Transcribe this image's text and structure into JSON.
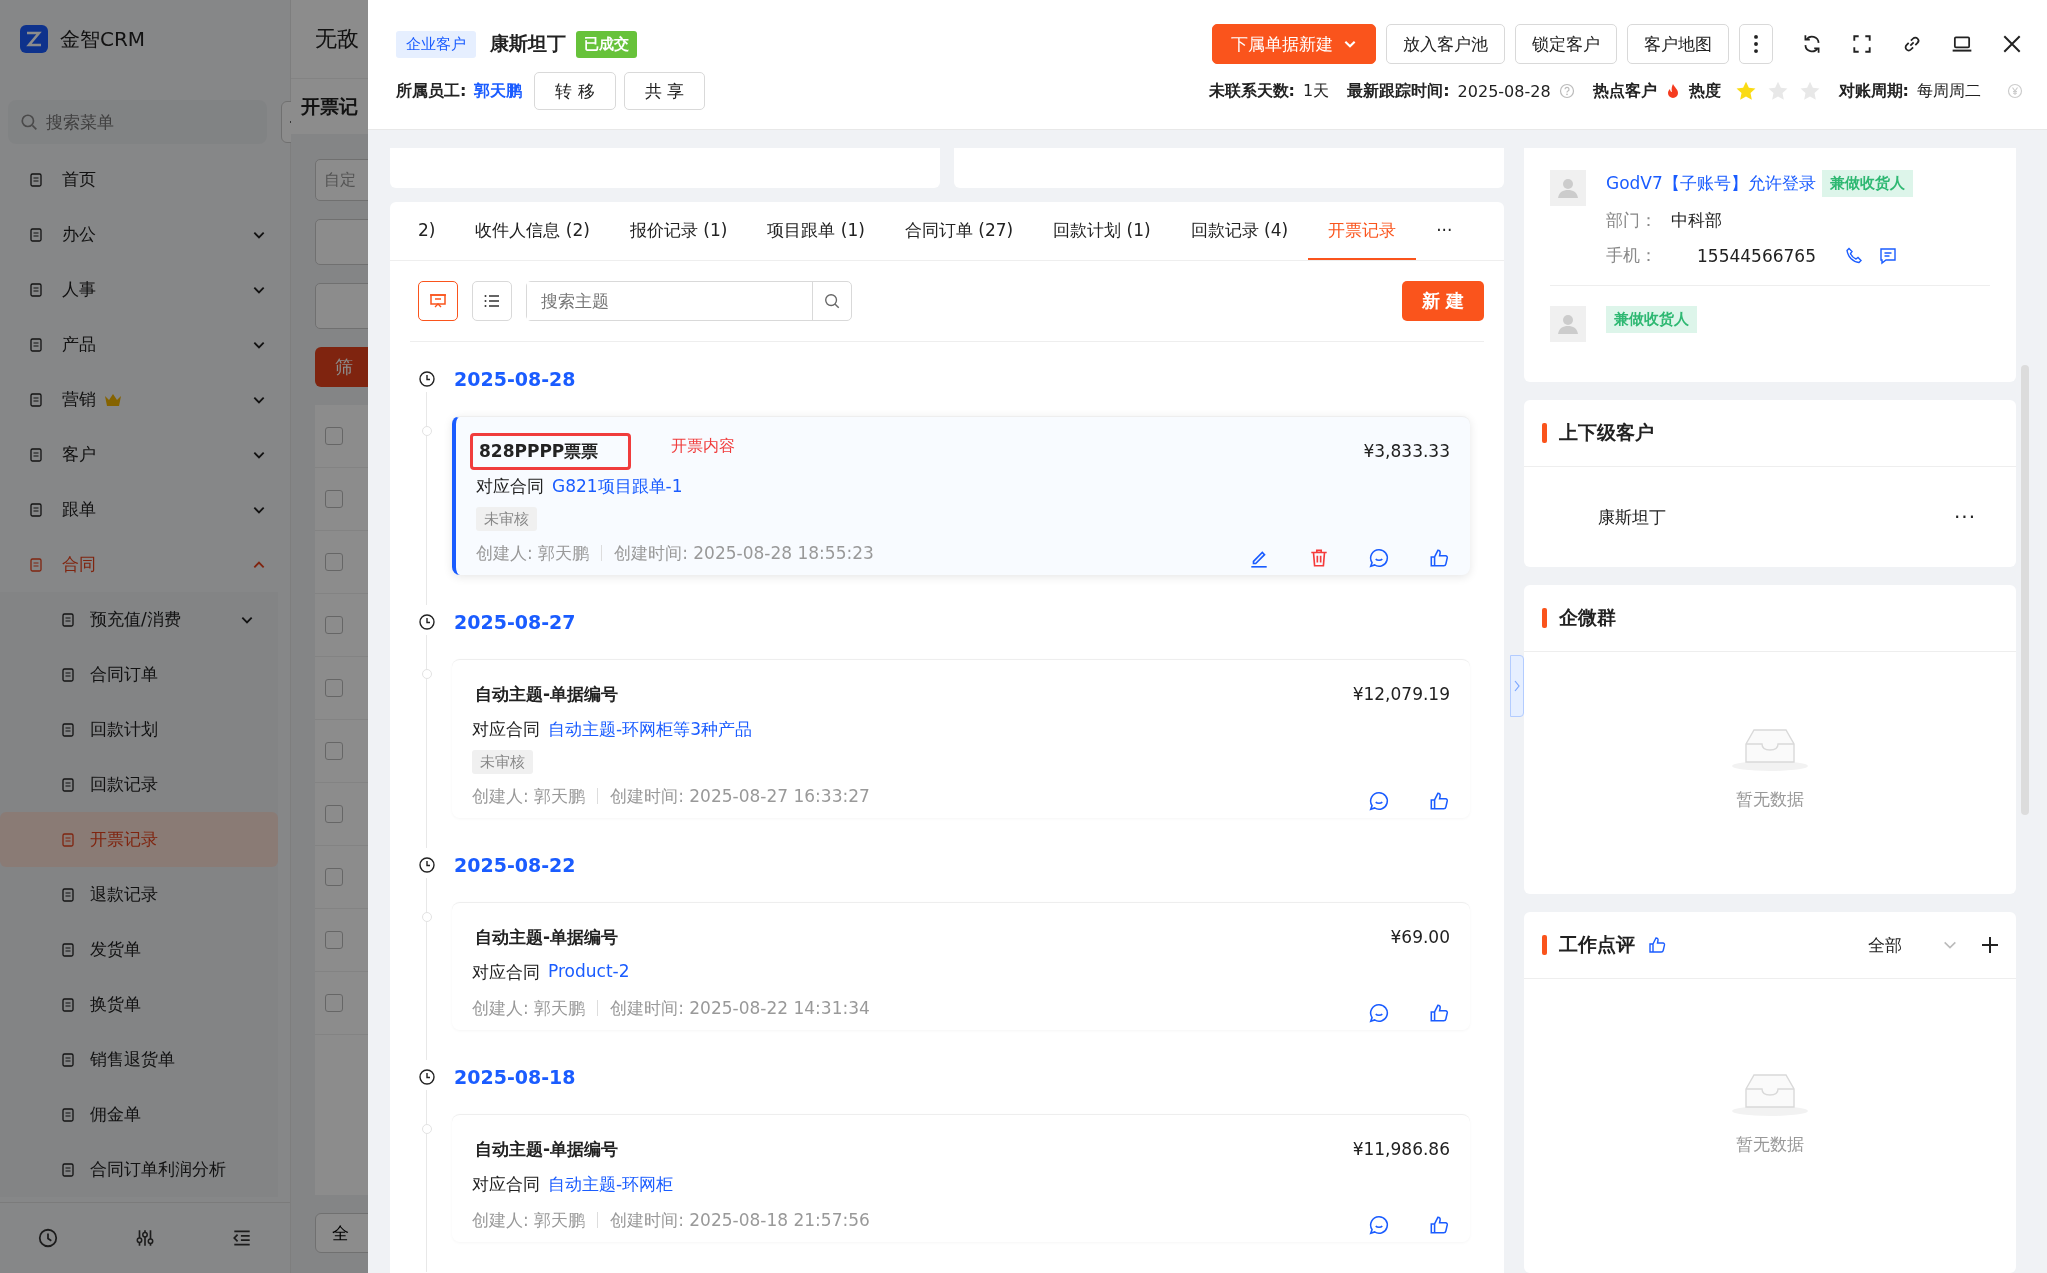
{
  "app": {
    "logo": "金智CRM",
    "search_placeholder": "搜索菜单",
    "page_title": "无敌",
    "section_title": "开票记",
    "filter_placeholder": "自定",
    "filter_button": "筛",
    "footer_button": "全",
    "table_rows": [
      {
        "checked": false
      },
      {
        "checked": false
      },
      {
        "checked": false
      },
      {
        "checked": false
      },
      {
        "checked": false
      },
      {
        "checked": false
      },
      {
        "checked": false
      },
      {
        "checked": false
      },
      {
        "checked": false
      },
      {
        "checked": false
      }
    ]
  },
  "sidebar": {
    "items": [
      {
        "label": "首页",
        "kind": "link",
        "selected": false,
        "premium": false
      },
      {
        "label": "办公",
        "kind": "group",
        "selected": false,
        "expanded": false,
        "premium": false
      },
      {
        "label": "人事",
        "kind": "group",
        "selected": false,
        "expanded": false,
        "premium": false
      },
      {
        "label": "产品",
        "kind": "group",
        "selected": false,
        "expanded": false,
        "premium": false
      },
      {
        "label": "营销",
        "kind": "group",
        "selected": false,
        "expanded": false,
        "premium": true
      },
      {
        "label": "客户",
        "kind": "group",
        "selected": false,
        "expanded": false,
        "premium": false
      },
      {
        "label": "跟单",
        "kind": "group",
        "selected": false,
        "expanded": false,
        "premium": false
      },
      {
        "label": "合同",
        "kind": "group",
        "selected": true,
        "expanded": true,
        "premium": false,
        "children": [
          {
            "label": "预充值/消费",
            "kind": "group",
            "selected": false
          },
          {
            "label": "合同订单",
            "kind": "link",
            "selected": false
          },
          {
            "label": "回款计划",
            "kind": "link",
            "selected": false
          },
          {
            "label": "回款记录",
            "kind": "link",
            "selected": false
          },
          {
            "label": "开票记录",
            "kind": "link",
            "selected": true
          },
          {
            "label": "退款记录",
            "kind": "link",
            "selected": false
          },
          {
            "label": "发货单",
            "kind": "link",
            "selected": false
          },
          {
            "label": "换货单",
            "kind": "link",
            "selected": false
          },
          {
            "label": "销售退货单",
            "kind": "link",
            "selected": false
          },
          {
            "label": "佣金单",
            "kind": "link",
            "selected": false
          },
          {
            "label": "合同订单利润分析",
            "kind": "link",
            "selected": false
          }
        ]
      }
    ]
  },
  "customer": {
    "type_tag": "企业客户",
    "name": "康斯坦丁",
    "status": "已成交"
  },
  "header_buttons": [
    {
      "label": "下属单据新建",
      "kind": "primary"
    },
    {
      "label": "放入客户池",
      "kind": "default"
    },
    {
      "label": "锁定客户",
      "kind": "default"
    },
    {
      "label": "客户地图",
      "kind": "default"
    }
  ],
  "owner": {
    "label": "所属员工:",
    "name": "郭天鹏",
    "buttons": [
      "转 移",
      "共 享"
    ]
  },
  "stats": {
    "uncontacted_label": "未联系天数:",
    "uncontacted": "1天",
    "last_follow_label": "最新跟踪时间:",
    "last_follow": "2025-08-28",
    "hot_label": "热点客户",
    "heat_label": "热度",
    "stars": 1,
    "cycle_label": "对账周期:",
    "cycle": "每周周二"
  },
  "tabs": [
    {
      "label": "2)",
      "selected": false
    },
    {
      "label": "收件人信息 (2)",
      "selected": false
    },
    {
      "label": "报价记录 (1)",
      "selected": false
    },
    {
      "label": "项目跟单 (1)",
      "selected": false
    },
    {
      "label": "合同订单 (27)",
      "selected": false
    },
    {
      "label": "回款计划 (1)",
      "selected": false
    },
    {
      "label": "回款记录 (4)",
      "selected": false
    },
    {
      "label": "开票记录",
      "selected": true
    }
  ],
  "tabs_more": "···",
  "toolbar": {
    "views": [
      {
        "kind": "card",
        "selected": true
      },
      {
        "kind": "list",
        "selected": false
      }
    ],
    "search_placeholder": "搜索主题",
    "new_button": "新 建"
  },
  "timeline": [
    {
      "date": "2025-08-28",
      "record": {
        "title": "828PPPP票票",
        "highlighted": true,
        "note": "开票内容",
        "amount": "¥3,833.33",
        "contract_label": "对应合同",
        "contract": "G821项目跟单-1",
        "status": "未审核",
        "creator": "创建人: 郭天鹏",
        "created": "创建时间: 2025-08-28 18:55:23",
        "selected": true,
        "actions": [
          {
            "kind": "edit"
          },
          {
            "kind": "delete"
          },
          {
            "kind": "comment"
          },
          {
            "kind": "like"
          }
        ]
      }
    },
    {
      "date": "2025-08-27",
      "record": {
        "title": "自动主题-单据编号",
        "highlighted": false,
        "amount": "¥12,079.19",
        "contract_label": "对应合同",
        "contract": "自动主题-环网柜等3种产品",
        "status": "未审核",
        "creator": "创建人: 郭天鹏",
        "created": "创建时间: 2025-08-27 16:33:27",
        "selected": false,
        "actions": [
          {
            "kind": "comment"
          },
          {
            "kind": "like"
          }
        ]
      }
    },
    {
      "date": "2025-08-22",
      "record": {
        "title": "自动主题-单据编号",
        "highlighted": false,
        "amount": "¥69.00",
        "contract_label": "对应合同",
        "contract": "Product-2",
        "creator": "创建人: 郭天鹏",
        "created": "创建时间: 2025-08-22 14:31:34",
        "selected": false,
        "actions": [
          {
            "kind": "comment"
          },
          {
            "kind": "like"
          }
        ]
      }
    },
    {
      "date": "2025-08-18",
      "record": {
        "title": "自动主题-单据编号",
        "highlighted": false,
        "amount": "¥11,986.86",
        "contract_label": "对应合同",
        "contract": "自动主题-环网柜",
        "creator": "创建人: 郭天鹏",
        "created": "创建时间: 2025-08-18 21:57:56",
        "selected": false,
        "actions": [
          {
            "kind": "comment"
          },
          {
            "kind": "like"
          }
        ]
      }
    }
  ],
  "contacts": [
    {
      "name": "GodV7【子账号】允许登录",
      "tag": "兼做收货人",
      "dept_label": "部门：",
      "dept": "中科部",
      "phone_label": "手机：",
      "phone": "15544566765"
    },
    {
      "tag": "兼做收货人"
    }
  ],
  "related": {
    "title": "上下级客户",
    "rows": [
      {
        "name": "康斯坦丁",
        "more": "···"
      }
    ]
  },
  "wecom": {
    "title": "企微群",
    "empty": "暂无数据"
  },
  "review": {
    "title": "工作点评",
    "filter": "全部",
    "empty": "暂无数据"
  }
}
